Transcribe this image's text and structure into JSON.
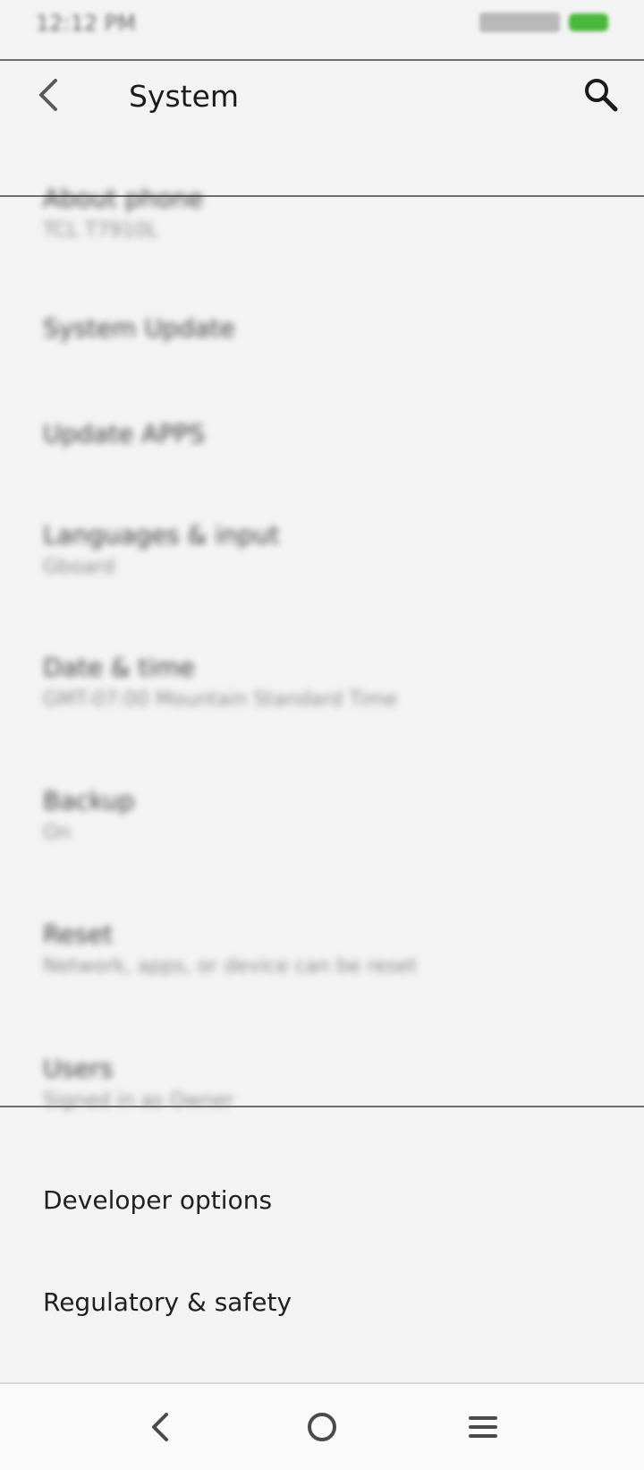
{
  "status_bar": {
    "time": "12:12 PM",
    "battery_color": "#49b83c"
  },
  "app_bar": {
    "title": "System",
    "back_icon": "arrow-back-icon",
    "search_icon": "search-icon"
  },
  "items": [
    {
      "title": "About phone",
      "subtitle": "TCL T7910L"
    },
    {
      "title": "System Update",
      "subtitle": ""
    },
    {
      "title": "Update APPS",
      "subtitle": ""
    },
    {
      "title": "Languages & input",
      "subtitle": "Gboard"
    },
    {
      "title": "Date & time",
      "subtitle": "GMT-07:00 Mountain Standard Time"
    },
    {
      "title": "Backup",
      "subtitle": "On"
    },
    {
      "title": "Reset",
      "subtitle": "Network, apps, or device can be reset"
    },
    {
      "title": "Users",
      "subtitle": "Signed in as Owner"
    },
    {
      "title": "Developer options",
      "subtitle": ""
    },
    {
      "title": "Regulatory & safety",
      "subtitle": ""
    }
  ],
  "nav_bar": {
    "back_icon": "nav-back-icon",
    "home_icon": "home-icon",
    "recents_icon": "menu-icon"
  }
}
